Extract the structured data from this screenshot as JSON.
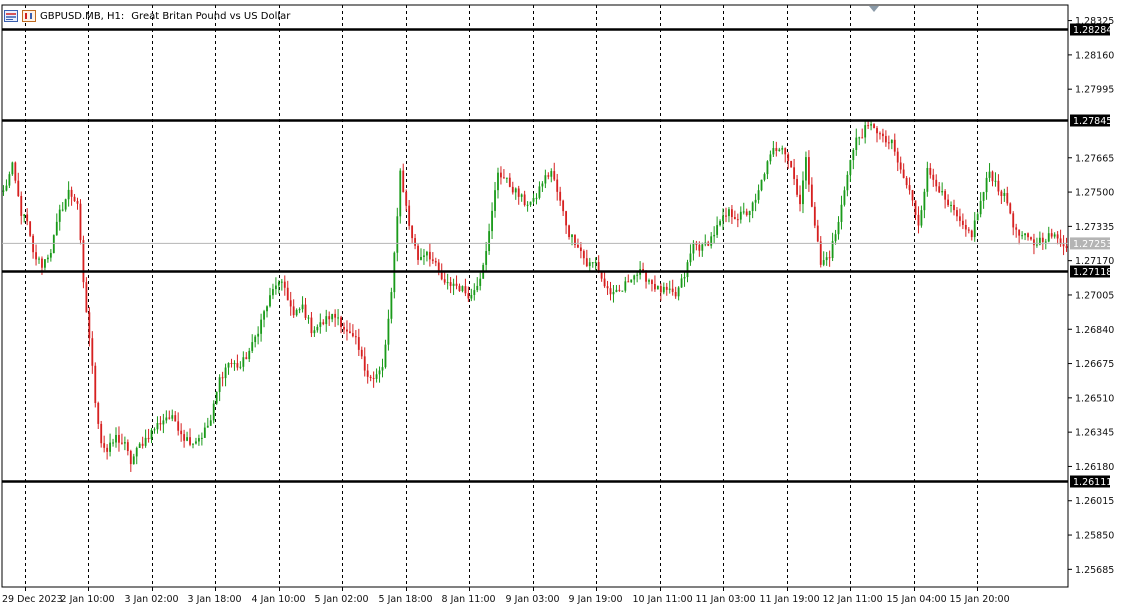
{
  "header": {
    "symbol": "GBPUSD.MB, H1:",
    "description": "Great Britan Pound vs US Dollar"
  },
  "colors": {
    "bull": "#1a9a1a",
    "bear": "#d62020",
    "level_line": "#000000",
    "grid": "#000000",
    "bid_line": "#b4b4b4",
    "bid_label_bg": "#b4b4b4"
  },
  "chart_data": {
    "type": "candlestick",
    "timeframe": "H1",
    "price_axis_ticks": [
      "1.28325",
      "1.28160",
      "1.27995",
      "1.27665",
      "1.27500",
      "1.27335",
      "1.27170",
      "1.27005",
      "1.26840",
      "1.26675",
      "1.26510",
      "1.26345",
      "1.26180",
      "1.26015",
      "1.25850",
      "1.25685"
    ],
    "time_axis_labels": [
      "29 Dec 2023",
      "2 Jan 10:00",
      "3 Jan 02:00",
      "3 Jan 18:00",
      "4 Jan 10:00",
      "5 Jan 02:00",
      "5 Jan 18:00",
      "8 Jan 11:00",
      "9 Jan 03:00",
      "9 Jan 19:00",
      "10 Jan 11:00",
      "11 Jan 03:00",
      "11 Jan 19:00",
      "12 Jan 11:00",
      "15 Jan 04:00",
      "15 Jan 20:00"
    ],
    "horizontal_levels": [
      "1.28284",
      "1.27845",
      "1.27118",
      "1.26111"
    ],
    "bid_price": "1.27253",
    "ylim": [
      1.256,
      1.284
    ],
    "anchors": [
      [
        0,
        1.275
      ],
      [
        3,
        1.2762
      ],
      [
        6,
        1.274
      ],
      [
        8,
        1.2735
      ],
      [
        10,
        1.272
      ],
      [
        13,
        1.2715
      ],
      [
        16,
        1.2722
      ],
      [
        19,
        1.274
      ],
      [
        22,
        1.275
      ],
      [
        25,
        1.2745
      ],
      [
        27,
        1.2705
      ],
      [
        29,
        1.268
      ],
      [
        31,
        1.265
      ],
      [
        33,
        1.263
      ],
      [
        35,
        1.2625
      ],
      [
        38,
        1.2632
      ],
      [
        41,
        1.2628
      ],
      [
        43,
        1.262
      ],
      [
        46,
        1.2628
      ],
      [
        49,
        1.2633
      ],
      [
        52,
        1.2638
      ],
      [
        55,
        1.2642
      ],
      [
        58,
        1.264
      ],
      [
        61,
        1.2632
      ],
      [
        64,
        1.263
      ],
      [
        67,
        1.2633
      ],
      [
        70,
        1.264
      ],
      [
        73,
        1.266
      ],
      [
        76,
        1.2668
      ],
      [
        80,
        1.2666
      ],
      [
        84,
        1.2676
      ],
      [
        88,
        1.2692
      ],
      [
        92,
        1.2706
      ],
      [
        95,
        1.2704
      ],
      [
        98,
        1.269
      ],
      [
        101,
        1.2695
      ],
      [
        104,
        1.2684
      ],
      [
        107,
        1.2686
      ],
      [
        110,
        1.269
      ],
      [
        113,
        1.269
      ],
      [
        116,
        1.2682
      ],
      [
        119,
        1.2678
      ],
      [
        122,
        1.2665
      ],
      [
        125,
        1.266
      ],
      [
        128,
        1.2665
      ],
      [
        131,
        1.27
      ],
      [
        134,
        1.276
      ],
      [
        137,
        1.2734
      ],
      [
        140,
        1.2718
      ],
      [
        143,
        1.2722
      ],
      [
        146,
        1.2714
      ],
      [
        149,
        1.2705
      ],
      [
        152,
        1.2706
      ],
      [
        155,
        1.2703
      ],
      [
        158,
        1.27
      ],
      [
        161,
        1.271
      ],
      [
        164,
        1.273
      ],
      [
        167,
        1.276
      ],
      [
        170,
        1.2755
      ],
      [
        173,
        1.275
      ],
      [
        176,
        1.2745
      ],
      [
        179,
        1.2745
      ],
      [
        182,
        1.2755
      ],
      [
        185,
        1.276
      ],
      [
        188,
        1.2745
      ],
      [
        191,
        1.273
      ],
      [
        194,
        1.2725
      ],
      [
        197,
        1.2715
      ],
      [
        200,
        1.2716
      ],
      [
        203,
        1.2705
      ],
      [
        206,
        1.27
      ],
      [
        209,
        1.2703
      ],
      [
        212,
        1.271
      ],
      [
        215,
        1.2711
      ],
      [
        218,
        1.2708
      ],
      [
        221,
        1.2703
      ],
      [
        224,
        1.2702
      ],
      [
        227,
        1.27
      ],
      [
        230,
        1.271
      ],
      [
        233,
        1.2725
      ],
      [
        236,
        1.2723
      ],
      [
        239,
        1.2728
      ],
      [
        242,
        1.2735
      ],
      [
        245,
        1.274
      ],
      [
        248,
        1.2738
      ],
      [
        251,
        1.274
      ],
      [
        254,
        1.2745
      ],
      [
        257,
        1.276
      ],
      [
        260,
        1.277
      ],
      [
        263,
        1.2773
      ],
      [
        266,
        1.2762
      ],
      [
        269,
        1.2745
      ],
      [
        271,
        1.2765
      ],
      [
        274,
        1.2735
      ],
      [
        276,
        1.2715
      ],
      [
        279,
        1.272
      ],
      [
        282,
        1.2735
      ],
      [
        285,
        1.276
      ],
      [
        288,
        1.2775
      ],
      [
        291,
        1.278
      ],
      [
        294,
        1.2782
      ],
      [
        297,
        1.2775
      ],
      [
        300,
        1.2773
      ],
      [
        303,
        1.276
      ],
      [
        306,
        1.275
      ],
      [
        309,
        1.2735
      ],
      [
        312,
        1.276
      ],
      [
        315,
        1.2755
      ],
      [
        318,
        1.2745
      ],
      [
        321,
        1.274
      ],
      [
        324,
        1.2732
      ],
      [
        327,
        1.273
      ],
      [
        330,
        1.2745
      ],
      [
        333,
        1.276
      ],
      [
        336,
        1.2752
      ],
      [
        339,
        1.2745
      ],
      [
        342,
        1.273
      ],
      [
        345,
        1.2728
      ],
      [
        348,
        1.2725
      ],
      [
        351,
        1.2728
      ],
      [
        354,
        1.2729
      ],
      [
        357,
        1.2726
      ],
      [
        359,
        1.2725
      ]
    ]
  }
}
